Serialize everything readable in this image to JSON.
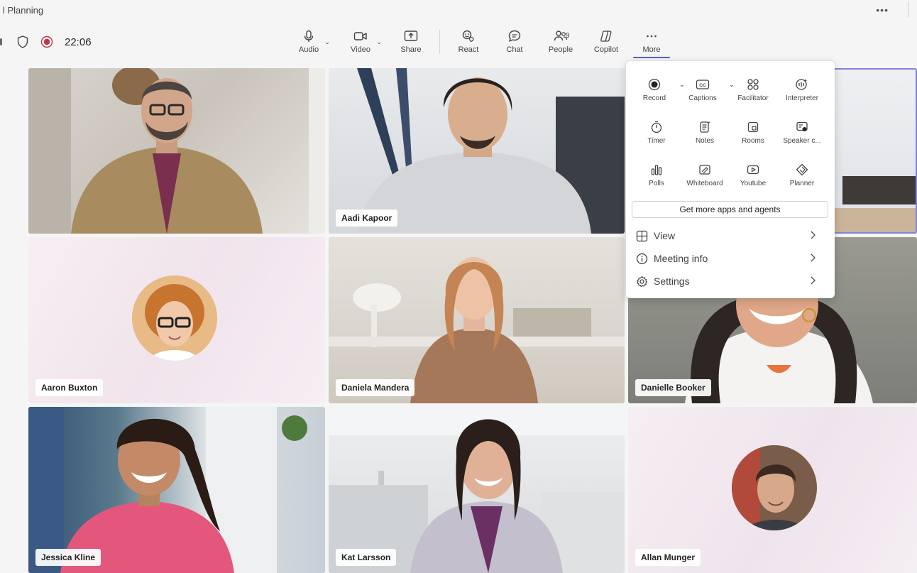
{
  "window": {
    "title": "l Planning"
  },
  "status": {
    "timer": "22:06"
  },
  "toolbar": {
    "audio": "Audio",
    "video": "Video",
    "share": "Share",
    "react": "React",
    "chat": "Chat",
    "people": "People",
    "people_count": "9",
    "copilot": "Copilot",
    "more": "More"
  },
  "more_menu": {
    "items": [
      {
        "label": "Record",
        "icon": "record-icon"
      },
      {
        "label": "Captions",
        "icon": "captions-icon"
      },
      {
        "label": "Facilitator",
        "icon": "facilitator-icon"
      },
      {
        "label": "Interpreter",
        "icon": "interpreter-icon"
      },
      {
        "label": "Timer",
        "icon": "timer-icon"
      },
      {
        "label": "Notes",
        "icon": "notes-icon"
      },
      {
        "label": "Rooms",
        "icon": "rooms-icon"
      },
      {
        "label": "Speaker c...",
        "icon": "speaker-coach-icon"
      },
      {
        "label": "Polls",
        "icon": "polls-icon"
      },
      {
        "label": "Whiteboard",
        "icon": "whiteboard-icon"
      },
      {
        "label": "Youtube",
        "icon": "youtube-icon"
      },
      {
        "label": "Planner",
        "icon": "planner-icon"
      }
    ],
    "get_more": "Get more apps and agents",
    "view": "View",
    "meeting_info": "Meeting info",
    "settings": "Settings"
  },
  "participants": [
    {
      "name": ""
    },
    {
      "name": "Aadi Kapoor"
    },
    {
      "name": ""
    },
    {
      "name": "Aaron Buxton"
    },
    {
      "name": "Daniela Mandera"
    },
    {
      "name": "Danielle Booker"
    },
    {
      "name": "Jessica Kline"
    },
    {
      "name": "Kat Larsson"
    },
    {
      "name": "Allan Munger"
    }
  ],
  "colors": {
    "accent": "#5b5fc7",
    "record": "#c4314b"
  }
}
